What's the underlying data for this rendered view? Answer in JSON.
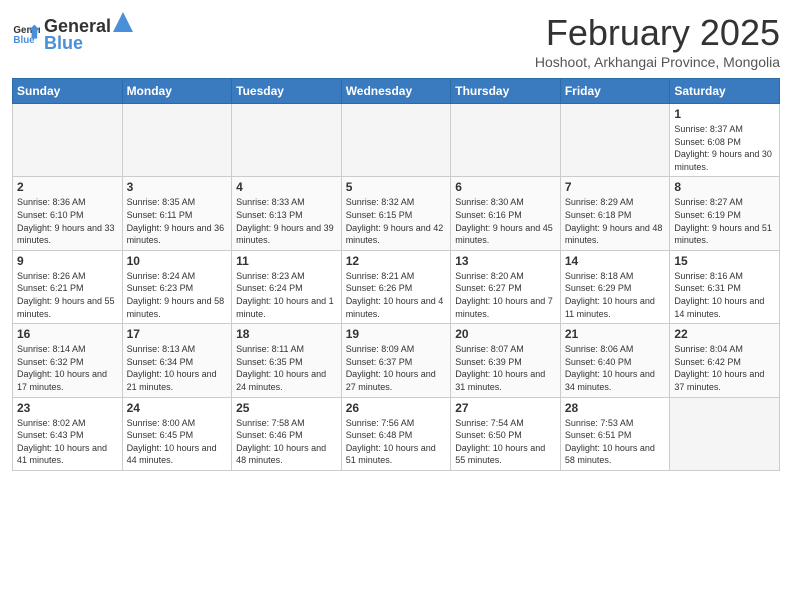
{
  "logo": {
    "general": "General",
    "blue": "Blue"
  },
  "title": "February 2025",
  "location": "Hoshoot, Arkhangai Province, Mongolia",
  "weekdays": [
    "Sunday",
    "Monday",
    "Tuesday",
    "Wednesday",
    "Thursday",
    "Friday",
    "Saturday"
  ],
  "weeks": [
    [
      {
        "day": "",
        "info": ""
      },
      {
        "day": "",
        "info": ""
      },
      {
        "day": "",
        "info": ""
      },
      {
        "day": "",
        "info": ""
      },
      {
        "day": "",
        "info": ""
      },
      {
        "day": "",
        "info": ""
      },
      {
        "day": "1",
        "info": "Sunrise: 8:37 AM\nSunset: 6:08 PM\nDaylight: 9 hours and 30 minutes."
      }
    ],
    [
      {
        "day": "2",
        "info": "Sunrise: 8:36 AM\nSunset: 6:10 PM\nDaylight: 9 hours and 33 minutes."
      },
      {
        "day": "3",
        "info": "Sunrise: 8:35 AM\nSunset: 6:11 PM\nDaylight: 9 hours and 36 minutes."
      },
      {
        "day": "4",
        "info": "Sunrise: 8:33 AM\nSunset: 6:13 PM\nDaylight: 9 hours and 39 minutes."
      },
      {
        "day": "5",
        "info": "Sunrise: 8:32 AM\nSunset: 6:15 PM\nDaylight: 9 hours and 42 minutes."
      },
      {
        "day": "6",
        "info": "Sunrise: 8:30 AM\nSunset: 6:16 PM\nDaylight: 9 hours and 45 minutes."
      },
      {
        "day": "7",
        "info": "Sunrise: 8:29 AM\nSunset: 6:18 PM\nDaylight: 9 hours and 48 minutes."
      },
      {
        "day": "8",
        "info": "Sunrise: 8:27 AM\nSunset: 6:19 PM\nDaylight: 9 hours and 51 minutes."
      }
    ],
    [
      {
        "day": "9",
        "info": "Sunrise: 8:26 AM\nSunset: 6:21 PM\nDaylight: 9 hours and 55 minutes."
      },
      {
        "day": "10",
        "info": "Sunrise: 8:24 AM\nSunset: 6:23 PM\nDaylight: 9 hours and 58 minutes."
      },
      {
        "day": "11",
        "info": "Sunrise: 8:23 AM\nSunset: 6:24 PM\nDaylight: 10 hours and 1 minute."
      },
      {
        "day": "12",
        "info": "Sunrise: 8:21 AM\nSunset: 6:26 PM\nDaylight: 10 hours and 4 minutes."
      },
      {
        "day": "13",
        "info": "Sunrise: 8:20 AM\nSunset: 6:27 PM\nDaylight: 10 hours and 7 minutes."
      },
      {
        "day": "14",
        "info": "Sunrise: 8:18 AM\nSunset: 6:29 PM\nDaylight: 10 hours and 11 minutes."
      },
      {
        "day": "15",
        "info": "Sunrise: 8:16 AM\nSunset: 6:31 PM\nDaylight: 10 hours and 14 minutes."
      }
    ],
    [
      {
        "day": "16",
        "info": "Sunrise: 8:14 AM\nSunset: 6:32 PM\nDaylight: 10 hours and 17 minutes."
      },
      {
        "day": "17",
        "info": "Sunrise: 8:13 AM\nSunset: 6:34 PM\nDaylight: 10 hours and 21 minutes."
      },
      {
        "day": "18",
        "info": "Sunrise: 8:11 AM\nSunset: 6:35 PM\nDaylight: 10 hours and 24 minutes."
      },
      {
        "day": "19",
        "info": "Sunrise: 8:09 AM\nSunset: 6:37 PM\nDaylight: 10 hours and 27 minutes."
      },
      {
        "day": "20",
        "info": "Sunrise: 8:07 AM\nSunset: 6:39 PM\nDaylight: 10 hours and 31 minutes."
      },
      {
        "day": "21",
        "info": "Sunrise: 8:06 AM\nSunset: 6:40 PM\nDaylight: 10 hours and 34 minutes."
      },
      {
        "day": "22",
        "info": "Sunrise: 8:04 AM\nSunset: 6:42 PM\nDaylight: 10 hours and 37 minutes."
      }
    ],
    [
      {
        "day": "23",
        "info": "Sunrise: 8:02 AM\nSunset: 6:43 PM\nDaylight: 10 hours and 41 minutes."
      },
      {
        "day": "24",
        "info": "Sunrise: 8:00 AM\nSunset: 6:45 PM\nDaylight: 10 hours and 44 minutes."
      },
      {
        "day": "25",
        "info": "Sunrise: 7:58 AM\nSunset: 6:46 PM\nDaylight: 10 hours and 48 minutes."
      },
      {
        "day": "26",
        "info": "Sunrise: 7:56 AM\nSunset: 6:48 PM\nDaylight: 10 hours and 51 minutes."
      },
      {
        "day": "27",
        "info": "Sunrise: 7:54 AM\nSunset: 6:50 PM\nDaylight: 10 hours and 55 minutes."
      },
      {
        "day": "28",
        "info": "Sunrise: 7:53 AM\nSunset: 6:51 PM\nDaylight: 10 hours and 58 minutes."
      },
      {
        "day": "",
        "info": ""
      }
    ]
  ]
}
